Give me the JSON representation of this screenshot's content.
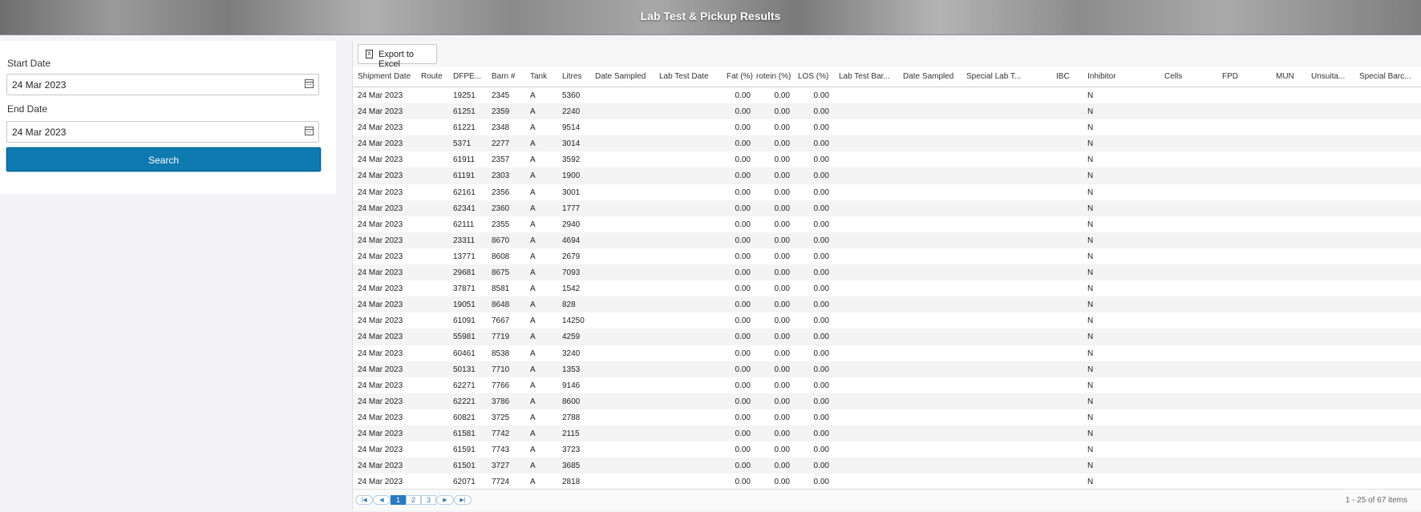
{
  "header": {
    "title": "Lab Test & Pickup Results"
  },
  "filters": {
    "start_label": "Start Date",
    "start_value": "24 Mar 2023",
    "end_label": "End Date",
    "end_value": "24 Mar 2023",
    "search_label": "Search"
  },
  "toolbar": {
    "export_label": "Export to Excel",
    "export_icon": "excel-file-icon"
  },
  "columns": {
    "shipment_date": "Shipment Date",
    "route": "Route",
    "dfpe": "DFPE...",
    "barn": "Barn #",
    "tank": "Tank",
    "litres": "Litres",
    "date_sampled": "Date Sampled",
    "lab_test_date": "Lab Test Date",
    "fat": "Fat (%)",
    "protein": "rotein (%)",
    "los": "LOS (%)",
    "lab_test_bar": "Lab Test Bar...",
    "date_sampled_2": "Date Sampled",
    "special_lab": "Special Lab T...",
    "ibc": "IBC",
    "inhibitor": "Inhibitor",
    "cells": "Cells",
    "fpd": "FPD",
    "mun": "MUN",
    "unsuita": "Unsuita...",
    "special_barc": "Special Barc..."
  },
  "rows": [
    {
      "date": "24 Mar 2023",
      "dfpe": "19251",
      "barn": "2345",
      "tank": "A",
      "litres": "5360",
      "fat": "0.00",
      "protein": "0.00",
      "los": "0.00",
      "inhibitor": "N"
    },
    {
      "date": "24 Mar 2023",
      "dfpe": "61251",
      "barn": "2359",
      "tank": "A",
      "litres": "2240",
      "fat": "0.00",
      "protein": "0.00",
      "los": "0.00",
      "inhibitor": "N"
    },
    {
      "date": "24 Mar 2023",
      "dfpe": "61221",
      "barn": "2348",
      "tank": "A",
      "litres": "9514",
      "fat": "0.00",
      "protein": "0.00",
      "los": "0.00",
      "inhibitor": "N"
    },
    {
      "date": "24 Mar 2023",
      "dfpe": "5371",
      "barn": "2277",
      "tank": "A",
      "litres": "3014",
      "fat": "0.00",
      "protein": "0.00",
      "los": "0.00",
      "inhibitor": "N"
    },
    {
      "date": "24 Mar 2023",
      "dfpe": "61911",
      "barn": "2357",
      "tank": "A",
      "litres": "3592",
      "fat": "0.00",
      "protein": "0.00",
      "los": "0.00",
      "inhibitor": "N"
    },
    {
      "date": "24 Mar 2023",
      "dfpe": "61191",
      "barn": "2303",
      "tank": "A",
      "litres": "1900",
      "fat": "0.00",
      "protein": "0.00",
      "los": "0.00",
      "inhibitor": "N"
    },
    {
      "date": "24 Mar 2023",
      "dfpe": "62161",
      "barn": "2356",
      "tank": "A",
      "litres": "3001",
      "fat": "0.00",
      "protein": "0.00",
      "los": "0.00",
      "inhibitor": "N"
    },
    {
      "date": "24 Mar 2023",
      "dfpe": "62341",
      "barn": "2360",
      "tank": "A",
      "litres": "1777",
      "fat": "0.00",
      "protein": "0.00",
      "los": "0.00",
      "inhibitor": "N"
    },
    {
      "date": "24 Mar 2023",
      "dfpe": "62111",
      "barn": "2355",
      "tank": "A",
      "litres": "2940",
      "fat": "0.00",
      "protein": "0.00",
      "los": "0.00",
      "inhibitor": "N"
    },
    {
      "date": "24 Mar 2023",
      "dfpe": "23311",
      "barn": "8670",
      "tank": "A",
      "litres": "4694",
      "fat": "0.00",
      "protein": "0.00",
      "los": "0.00",
      "inhibitor": "N"
    },
    {
      "date": "24 Mar 2023",
      "dfpe": "13771",
      "barn": "8608",
      "tank": "A",
      "litres": "2679",
      "fat": "0.00",
      "protein": "0.00",
      "los": "0.00",
      "inhibitor": "N"
    },
    {
      "date": "24 Mar 2023",
      "dfpe": "29681",
      "barn": "8675",
      "tank": "A",
      "litres": "7093",
      "fat": "0.00",
      "protein": "0.00",
      "los": "0.00",
      "inhibitor": "N"
    },
    {
      "date": "24 Mar 2023",
      "dfpe": "37871",
      "barn": "8581",
      "tank": "A",
      "litres": "1542",
      "fat": "0.00",
      "protein": "0.00",
      "los": "0.00",
      "inhibitor": "N"
    },
    {
      "date": "24 Mar 2023",
      "dfpe": "19051",
      "barn": "8648",
      "tank": "A",
      "litres": "828",
      "fat": "0.00",
      "protein": "0.00",
      "los": "0.00",
      "inhibitor": "N"
    },
    {
      "date": "24 Mar 2023",
      "dfpe": "61091",
      "barn": "7667",
      "tank": "A",
      "litres": "14250",
      "fat": "0.00",
      "protein": "0.00",
      "los": "0.00",
      "inhibitor": "N"
    },
    {
      "date": "24 Mar 2023",
      "dfpe": "55981",
      "barn": "7719",
      "tank": "A",
      "litres": "4259",
      "fat": "0.00",
      "protein": "0.00",
      "los": "0.00",
      "inhibitor": "N"
    },
    {
      "date": "24 Mar 2023",
      "dfpe": "60461",
      "barn": "8538",
      "tank": "A",
      "litres": "3240",
      "fat": "0.00",
      "protein": "0.00",
      "los": "0.00",
      "inhibitor": "N"
    },
    {
      "date": "24 Mar 2023",
      "dfpe": "50131",
      "barn": "7710",
      "tank": "A",
      "litres": "1353",
      "fat": "0.00",
      "protein": "0.00",
      "los": "0.00",
      "inhibitor": "N"
    },
    {
      "date": "24 Mar 2023",
      "dfpe": "62271",
      "barn": "7766",
      "tank": "A",
      "litres": "9146",
      "fat": "0.00",
      "protein": "0.00",
      "los": "0.00",
      "inhibitor": "N"
    },
    {
      "date": "24 Mar 2023",
      "dfpe": "62221",
      "barn": "3786",
      "tank": "A",
      "litres": "8600",
      "fat": "0.00",
      "protein": "0.00",
      "los": "0.00",
      "inhibitor": "N"
    },
    {
      "date": "24 Mar 2023",
      "dfpe": "60821",
      "barn": "3725",
      "tank": "A",
      "litres": "2788",
      "fat": "0.00",
      "protein": "0.00",
      "los": "0.00",
      "inhibitor": "N"
    },
    {
      "date": "24 Mar 2023",
      "dfpe": "61581",
      "barn": "7742",
      "tank": "A",
      "litres": "2115",
      "fat": "0.00",
      "protein": "0.00",
      "los": "0.00",
      "inhibitor": "N"
    },
    {
      "date": "24 Mar 2023",
      "dfpe": "61591",
      "barn": "7743",
      "tank": "A",
      "litres": "3723",
      "fat": "0.00",
      "protein": "0.00",
      "los": "0.00",
      "inhibitor": "N"
    },
    {
      "date": "24 Mar 2023",
      "dfpe": "61501",
      "barn": "3727",
      "tank": "A",
      "litres": "3685",
      "fat": "0.00",
      "protein": "0.00",
      "los": "0.00",
      "inhibitor": "N"
    },
    {
      "date": "24 Mar 2023",
      "dfpe": "62071",
      "barn": "7724",
      "tank": "A",
      "litres": "2818",
      "fat": "0.00",
      "protein": "0.00",
      "los": "0.00",
      "inhibitor": "N"
    }
  ],
  "pager": {
    "first_icon": "first-page-icon",
    "prev_icon": "prev-page-icon",
    "next_icon": "next-page-icon",
    "last_icon": "last-page-icon",
    "pages": [
      "1",
      "2",
      "3"
    ],
    "current_page": "1",
    "info": "1 - 25 of 67 items"
  },
  "colors": {
    "accent": "#0f7ab0",
    "pager_active": "#2a7ac0"
  }
}
